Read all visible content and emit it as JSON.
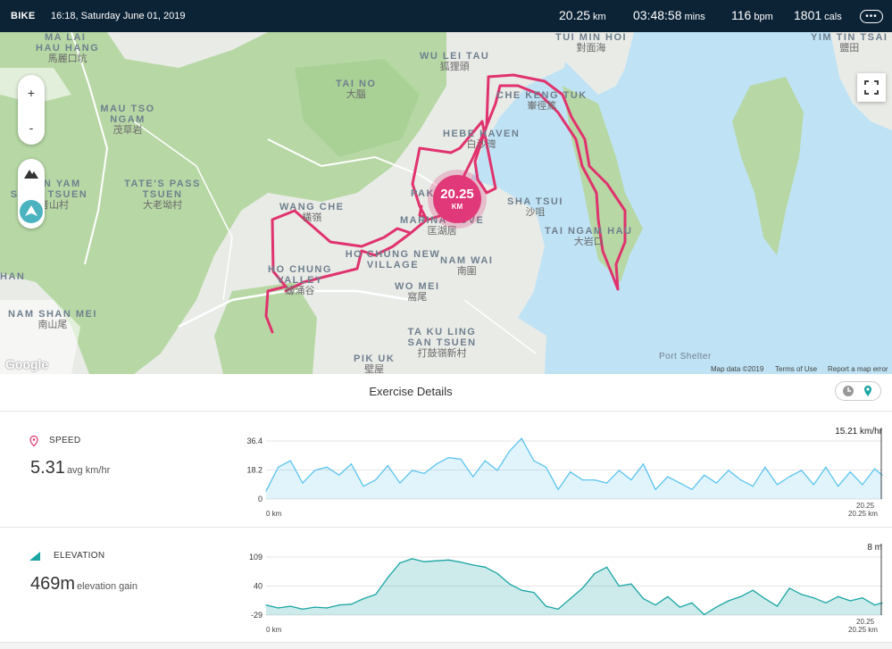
{
  "header": {
    "activity": "BIKE",
    "datetime": "16:18, Saturday June 01, 2019",
    "distance": {
      "value": "20.25",
      "unit": "km"
    },
    "duration": {
      "value": "03:48:58",
      "unit": "mins"
    },
    "heart_rate": {
      "value": "116",
      "unit": "bpm"
    },
    "calories": {
      "value": "1801",
      "unit": "cals"
    },
    "menu_icon": "ellipsis-icon"
  },
  "map": {
    "labels": [
      {
        "en": "MA LAI",
        "cn": ""
      },
      {
        "en": "HAU HANG",
        "cn": "馬麗口坑"
      },
      {
        "en": "WU LEI TAU",
        "cn": "狐狸頭"
      },
      {
        "en": "TUI MIN HOI",
        "cn": "對面海"
      },
      {
        "en": "YIM TIN TSAI",
        "cn": "鹽田"
      },
      {
        "en": "TAI NO",
        "cn": "大腦"
      },
      {
        "en": "MAU TSO NGAM",
        "cn": "茂草岩"
      },
      {
        "en": "CHE KENG TUK",
        "cn": "輋徑篤"
      },
      {
        "en": "HEBE HAVEN",
        "cn": "白沙灣"
      },
      {
        "en": "KOON YAM SHAN TSUEN",
        "cn": "觀音山村"
      },
      {
        "en": "TATE'S PASS TSUEN",
        "cn": "大老坳村"
      },
      {
        "en": "PAK WAI",
        "cn": ""
      },
      {
        "en": "SHA TSUI",
        "cn": "沙咀"
      },
      {
        "en": "WANG CHE",
        "cn": "橫嶺"
      },
      {
        "en": "MARINA COVE",
        "cn": "匡湖居"
      },
      {
        "en": "TAI NGAM HAU",
        "cn": "大岩口"
      },
      {
        "en": "HO CHUNG VALLEY",
        "cn": "蠔涌谷"
      },
      {
        "en": "HO CHUNG NEW VILLAGE",
        "cn": ""
      },
      {
        "en": "NAM WAI",
        "cn": "南圍"
      },
      {
        "en": "WO MEI",
        "cn": "窩尾"
      },
      {
        "en": "NAM SHAN MEI",
        "cn": "南山尾"
      },
      {
        "en": "TA KU LING SAN TSUEN",
        "cn": "打鼓嶺新村"
      },
      {
        "en": "PIK UK",
        "cn": "壁屋"
      },
      {
        "en": "HAN",
        "cn": ""
      },
      {
        "en": "Port Shelter",
        "cn": ""
      }
    ],
    "route_color": "#e0336e",
    "distance_marker": {
      "value": "20.25",
      "unit": "KM"
    },
    "controls": {
      "zoom_in": "+",
      "zoom_out": "-"
    },
    "attribution": {
      "map_data": "Map data ©2019",
      "terms": "Terms of Use",
      "report": "Report a map error",
      "google": "Google"
    }
  },
  "details": {
    "title": "Exercise Details",
    "toggle_icons": [
      "clock-icon",
      "map-pin-icon"
    ]
  },
  "speed": {
    "label": "SPEED",
    "icon": "map-pin-icon",
    "value": "5.31",
    "unit": "avg km/hr",
    "color": "#5bc4ee"
  },
  "elevation": {
    "label": "ELEVATION",
    "icon": "elevation-icon",
    "value": "469",
    "unit_big": "m",
    "unit": "elevation gain",
    "color": "#1aa5a3"
  },
  "chart_data": [
    {
      "type": "area",
      "title": "SPEED",
      "peak_value": "15.21 km/hr",
      "x_start_label": "0 km",
      "x_end_label": "20.25 km",
      "x_end_marker": "20.25",
      "xlim": [
        0,
        20.25
      ],
      "ylim": [
        0,
        36.4
      ],
      "y_ticks": [
        "36.4",
        "18.2",
        "0"
      ],
      "x": [
        0,
        0.4,
        0.8,
        1.2,
        1.6,
        2.0,
        2.4,
        2.8,
        3.2,
        3.6,
        4.0,
        4.4,
        4.8,
        5.2,
        5.6,
        6.0,
        6.4,
        6.8,
        7.2,
        7.6,
        8.0,
        8.4,
        8.8,
        9.2,
        9.6,
        10.0,
        10.4,
        10.8,
        11.2,
        11.6,
        12.0,
        12.4,
        12.8,
        13.2,
        13.6,
        14.0,
        14.4,
        14.8,
        15.2,
        15.6,
        16.0,
        16.4,
        16.8,
        17.2,
        17.6,
        18.0,
        18.4,
        18.8,
        19.2,
        19.6,
        20.0,
        20.25
      ],
      "values": [
        5,
        20,
        24,
        10,
        18,
        20,
        15,
        22,
        8,
        12,
        21,
        10,
        18,
        16,
        22,
        26,
        25,
        14,
        24,
        18,
        30,
        38,
        24,
        20,
        6,
        17,
        12,
        12,
        10,
        18,
        12,
        22,
        6,
        14,
        10,
        6,
        15,
        10,
        18,
        12,
        8,
        20,
        9,
        14,
        18,
        9,
        20,
        8,
        17,
        9,
        19,
        15
      ]
    },
    {
      "type": "area",
      "title": "ELEVATION",
      "peak_value": "8 m",
      "x_start_label": "0 km",
      "x_end_label": "20.25 km",
      "x_end_marker": "20.25",
      "xlim": [
        0,
        20.25
      ],
      "ylim": [
        -29,
        109
      ],
      "y_ticks": [
        "109",
        "40",
        "-29"
      ],
      "x": [
        0,
        0.4,
        0.8,
        1.2,
        1.6,
        2.0,
        2.4,
        2.8,
        3.2,
        3.6,
        4.0,
        4.4,
        4.8,
        5.2,
        5.6,
        6.0,
        6.4,
        6.8,
        7.2,
        7.6,
        8.0,
        8.4,
        8.8,
        9.2,
        9.6,
        10.0,
        10.4,
        10.8,
        11.2,
        11.6,
        12.0,
        12.4,
        12.8,
        13.2,
        13.6,
        14.0,
        14.4,
        14.8,
        15.2,
        15.6,
        16.0,
        16.4,
        16.8,
        17.2,
        17.6,
        18.0,
        18.4,
        18.8,
        19.2,
        19.6,
        20.0,
        20.25
      ],
      "values": [
        -5,
        -12,
        -8,
        -15,
        -10,
        -12,
        -5,
        -3,
        10,
        20,
        60,
        95,
        105,
        98,
        100,
        102,
        97,
        90,
        85,
        70,
        45,
        30,
        25,
        -8,
        -15,
        10,
        35,
        70,
        85,
        40,
        45,
        10,
        -5,
        15,
        -10,
        0,
        -28,
        -10,
        5,
        15,
        30,
        10,
        -8,
        35,
        20,
        12,
        0,
        15,
        5,
        12,
        -5,
        0
      ]
    }
  ]
}
